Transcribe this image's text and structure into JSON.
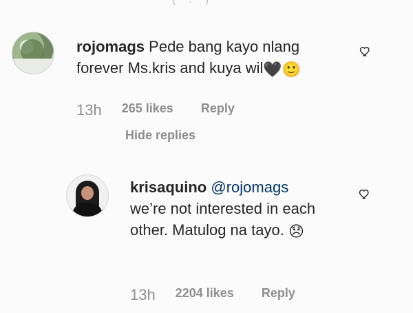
{
  "thread": {
    "top_sliver_text": "( . )",
    "comments": [
      {
        "username": "rojomags",
        "text": "Pede bang kayo nlang forever Ms.kris and kuya wil",
        "emoji_text": "🖤🙂",
        "time": "13h",
        "likes": "265 likes",
        "reply": "Reply",
        "hide_replies": "Hide replies"
      },
      {
        "username": "krisaquino",
        "mention": "@rojomags",
        "text": "we’re not interested in each other. Matulog na tayo.",
        "emoji_text": "😞",
        "time": "13h",
        "likes": "2204 likes",
        "reply": "Reply"
      }
    ]
  }
}
